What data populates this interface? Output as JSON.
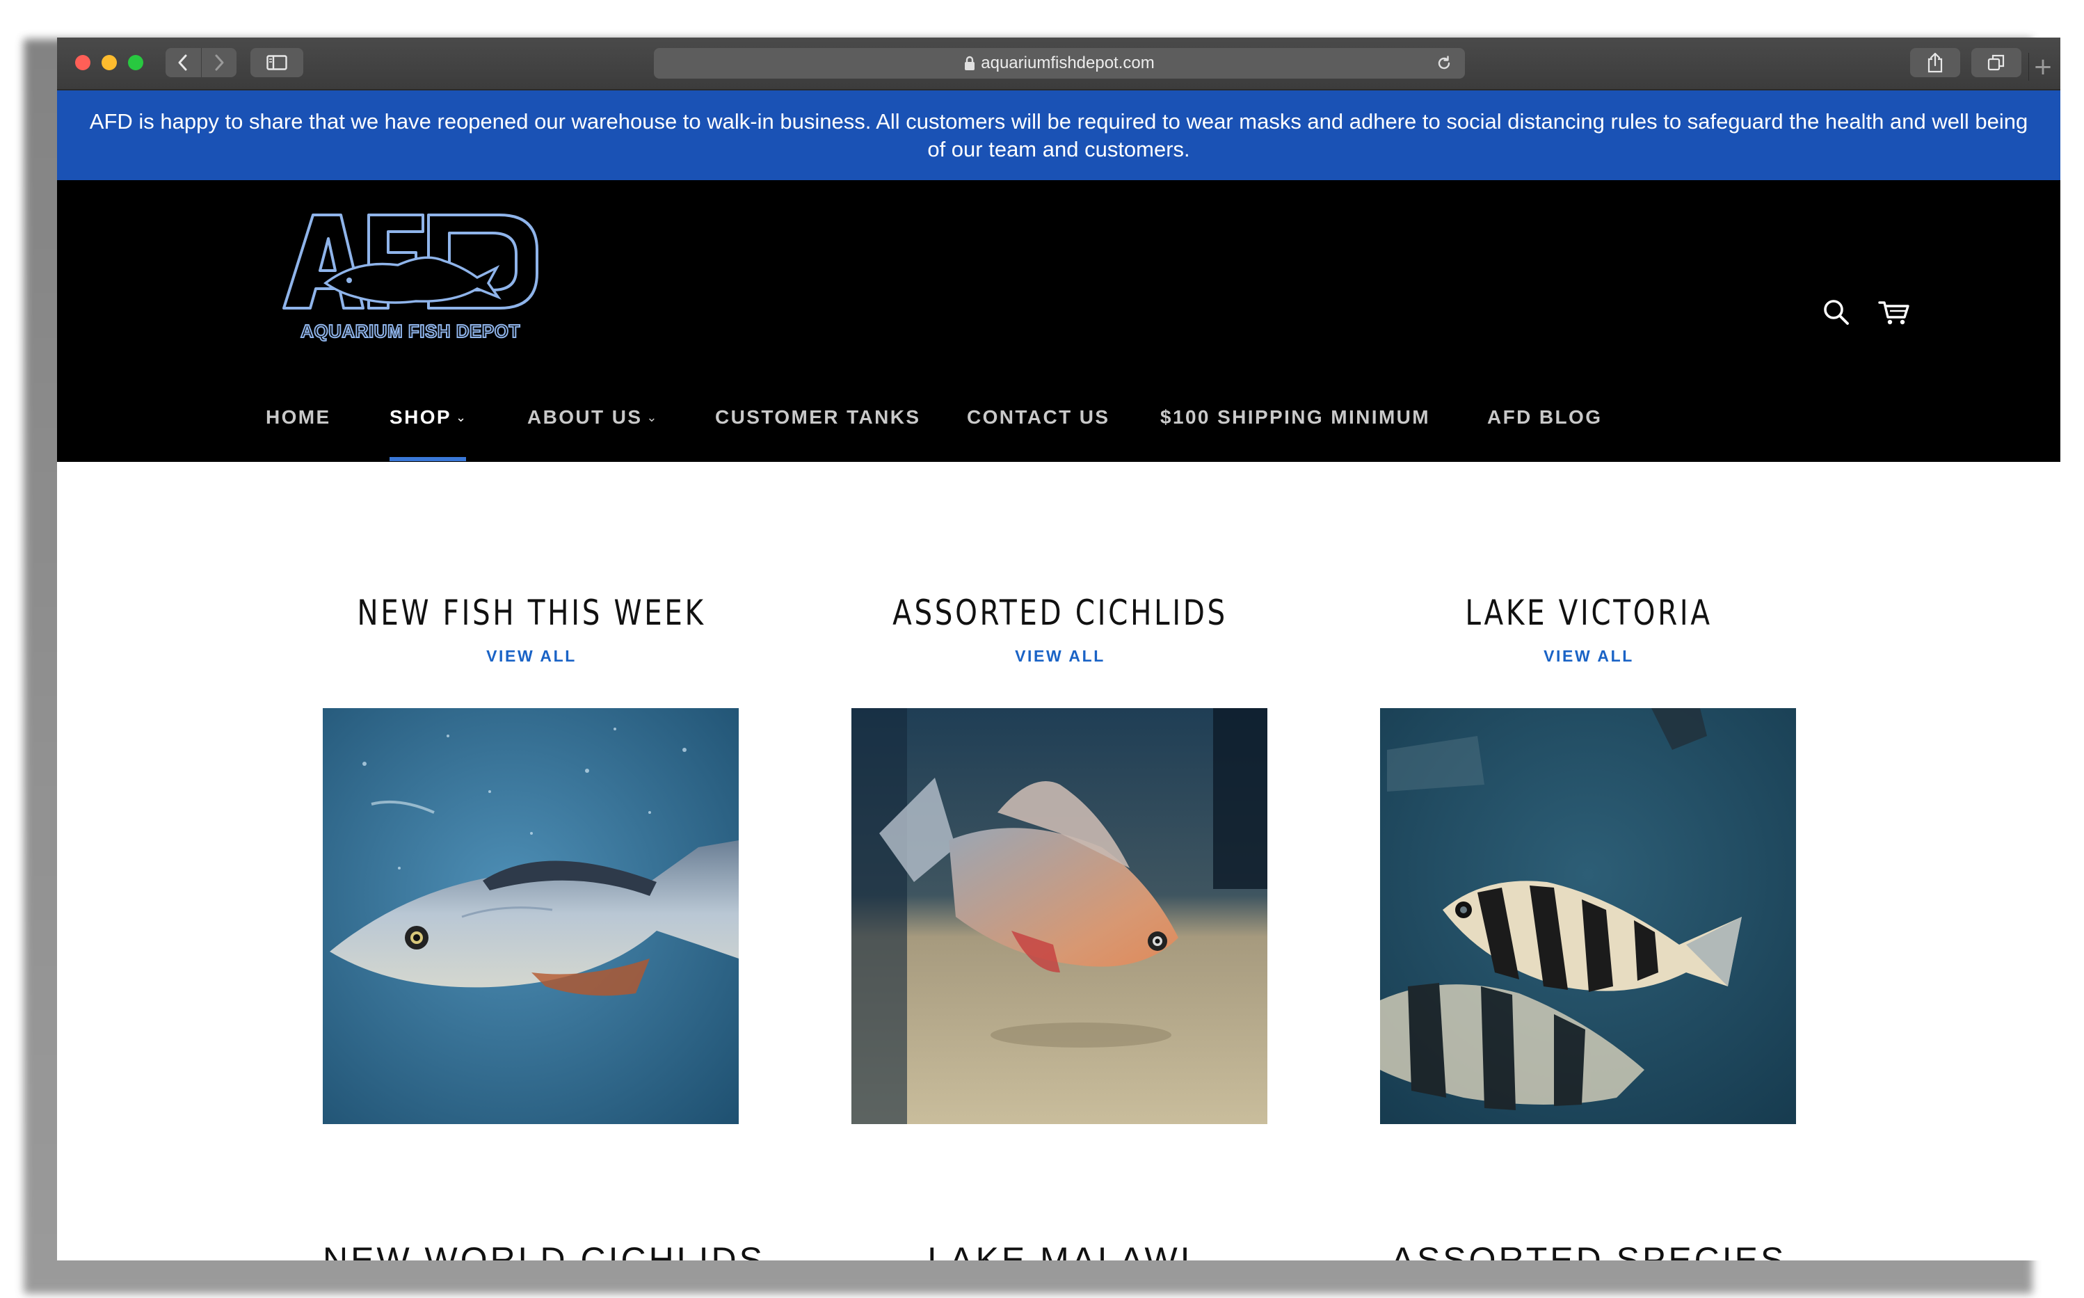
{
  "browser": {
    "url": "aquariumfishdepot.com",
    "new_tab_label": "+"
  },
  "announcement": {
    "text": "AFD is happy to share that we have reopened our warehouse to walk-in business. All customers will be required to wear masks and adhere to social distancing rules to safeguard the health and well being of our team and customers."
  },
  "logo": {
    "big_text": "AFD",
    "sub_text": "AQUARIUM FISH DEPOT"
  },
  "nav": {
    "items": [
      {
        "label": "HOME"
      },
      {
        "label": "SHOP"
      },
      {
        "label": "ABOUT US"
      },
      {
        "label": "CUSTOMER TANKS"
      },
      {
        "label": "CONTACT US"
      },
      {
        "label": "$100 SHIPPING MINIMUM"
      },
      {
        "label": "AFD BLOG"
      }
    ],
    "caret": "⌄"
  },
  "collections": [
    {
      "title": "NEW FISH THIS WEEK",
      "link": "VIEW ALL"
    },
    {
      "title": "ASSORTED CICHLIDS",
      "link": "VIEW ALL"
    },
    {
      "title": "LAKE VICTORIA",
      "link": "VIEW ALL"
    },
    {
      "title": "NEW WORLD CICHLIDS"
    },
    {
      "title": "LAKE MALAWI"
    },
    {
      "title": "ASSORTED SPECIES"
    }
  ],
  "colors": {
    "announcement_bg": "#1a52b5",
    "accent": "#3a78d8",
    "link": "#1a63c6"
  }
}
